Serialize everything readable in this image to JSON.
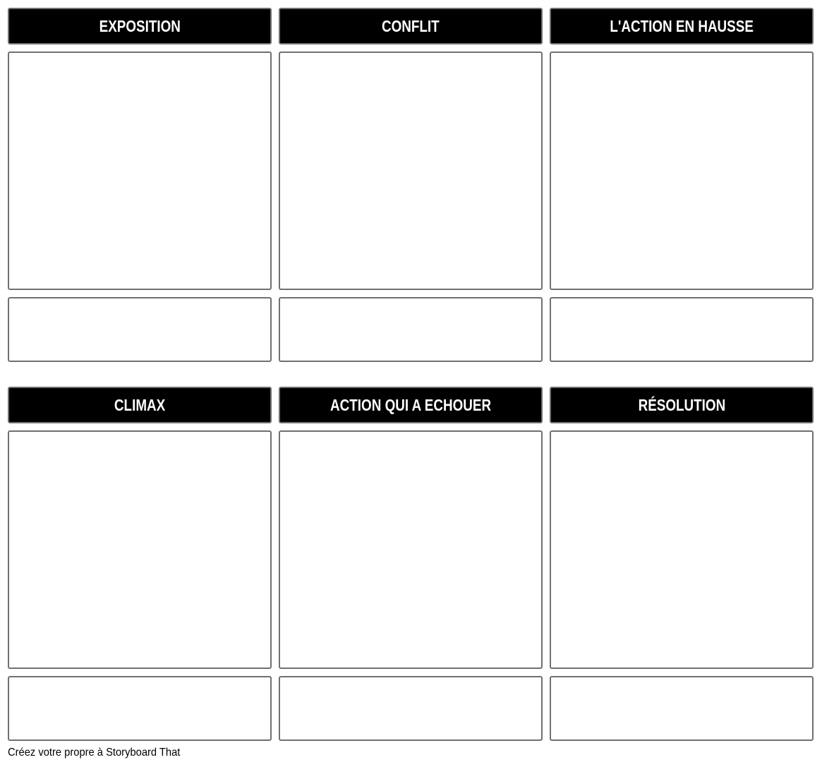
{
  "storyboard": {
    "cells": [
      {
        "title": "EXPOSITION"
      },
      {
        "title": "CONFLIT"
      },
      {
        "title": "L'ACTION EN HAUSSE"
      },
      {
        "title": "CLIMAX"
      },
      {
        "title": "ACTION QUI A ECHOUER"
      },
      {
        "title": "RÉSOLUTION"
      }
    ]
  },
  "footer": {
    "text": "Créez votre propre à Storyboard That"
  }
}
